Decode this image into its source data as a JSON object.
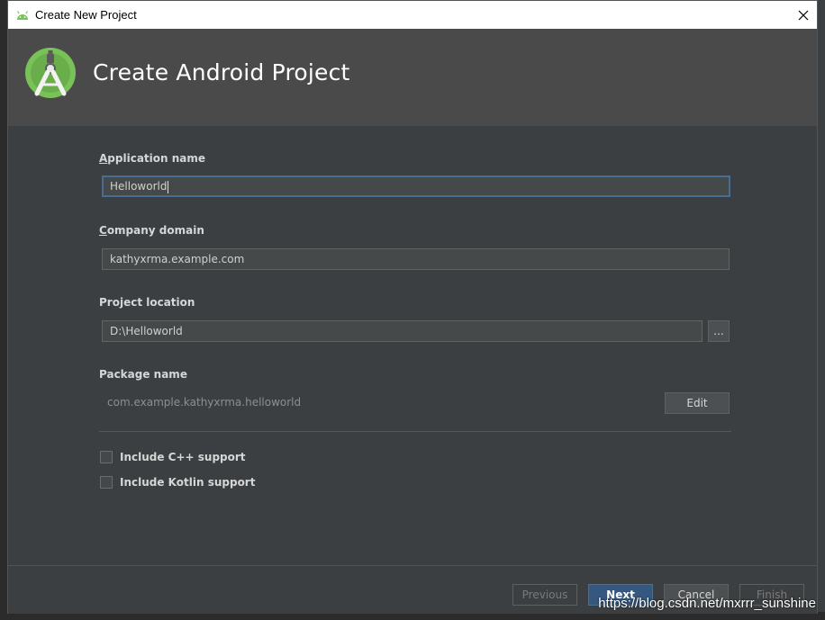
{
  "window": {
    "title": "Create New Project",
    "heading": "Create Android Project"
  },
  "form": {
    "app_name": {
      "label_mn": "A",
      "label_rest": "pplication name",
      "value": "Helloworld"
    },
    "company_domain": {
      "label_mn": "C",
      "label_rest": "ompany domain",
      "value": "kathyxrma.example.com"
    },
    "project_location": {
      "label": "Project location",
      "value": "D:\\Helloworld",
      "browse": "..."
    },
    "package_name": {
      "label": "Package name",
      "value": "com.example.kathyxrma.helloworld",
      "edit": "Edit"
    },
    "cpp_support": {
      "label": "Include C++ support",
      "checked": false
    },
    "kotlin_support": {
      "label": "Include Kotlin support",
      "checked": false
    }
  },
  "footer": {
    "previous": "Previous",
    "next": "Next",
    "cancel": "Cancel",
    "finish": "Finish"
  },
  "watermark": "https://blog.csdn.net/mxrrr_sunshine",
  "colors": {
    "accent": "#365880",
    "android_green": "#78c257",
    "dialog_bg": "#3c3f41",
    "banner_bg": "#4a4a4a"
  }
}
